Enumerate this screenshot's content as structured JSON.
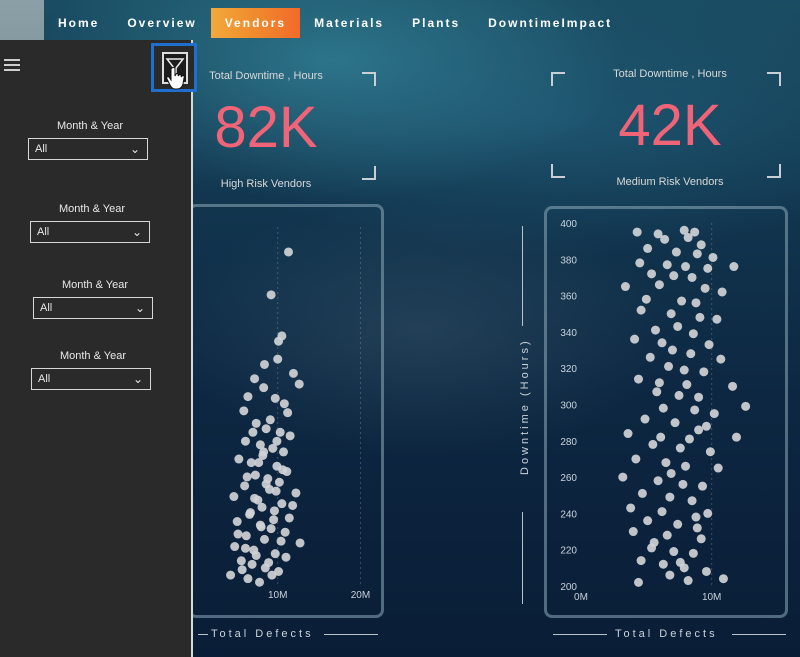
{
  "nav": {
    "tabs": [
      "Home",
      "Overview",
      "Vendors",
      "Materials",
      "Plants",
      "DowntimeImpact"
    ],
    "active": "Vendors"
  },
  "filters": [
    {
      "label": "Month & Year",
      "value": "All"
    },
    {
      "label": "Month & Year",
      "value": "All"
    },
    {
      "label": "Month & Year",
      "value": "All"
    },
    {
      "label": "Month & Year",
      "value": "All"
    }
  ],
  "kpi_high": {
    "title": "Total Downtime , Hours",
    "value": "82K",
    "subtitle": "High Risk Vendors"
  },
  "kpi_medium": {
    "title": "Total Downtime , Hours",
    "value": "42K",
    "subtitle": "Medium Risk Vendors"
  },
  "colors": {
    "accent": "#f06478",
    "active_tab": "#f08a2c",
    "point": "#d0d3d6",
    "filter_highlight": "#1e6fd0"
  },
  "icons": {
    "menu": "hamburger-icon",
    "filter": "filter-funnel-icon",
    "cursor": "hand-pointer-icon",
    "dropdown": "chevron-down-icon"
  },
  "chart_data": [
    {
      "type": "scatter",
      "title": "",
      "xlabel": "Total Defects",
      "ylabel": "",
      "x_ticks": [
        "10M",
        "20M"
      ],
      "xlim": [
        0,
        22
      ],
      "ylim": [
        200,
        400
      ],
      "points": [
        [
          11.3,
          386
        ],
        [
          9.2,
          362
        ],
        [
          10.5,
          339
        ],
        [
          10.1,
          336
        ],
        [
          8.4,
          323
        ],
        [
          10.0,
          326
        ],
        [
          7.2,
          315
        ],
        [
          11.9,
          318
        ],
        [
          8.3,
          310
        ],
        [
          12.6,
          312
        ],
        [
          6.4,
          305
        ],
        [
          9.7,
          304
        ],
        [
          10.8,
          301
        ],
        [
          11.2,
          296
        ],
        [
          5.9,
          297
        ],
        [
          9.1,
          292
        ],
        [
          7.4,
          290
        ],
        [
          8.6,
          287
        ],
        [
          10.3,
          285
        ],
        [
          11.5,
          283
        ],
        [
          6.1,
          280
        ],
        [
          7.9,
          278
        ],
        [
          9.4,
          276
        ],
        [
          10.7,
          274
        ],
        [
          8.2,
          272
        ],
        [
          5.3,
          270
        ],
        [
          6.8,
          268
        ],
        [
          9.9,
          266
        ],
        [
          11.1,
          263
        ],
        [
          7.3,
          261
        ],
        [
          8.8,
          259
        ],
        [
          10.2,
          257
        ],
        [
          6.0,
          255
        ],
        [
          9.0,
          253
        ],
        [
          12.2,
          251
        ],
        [
          4.7,
          249
        ],
        [
          7.6,
          247
        ],
        [
          10.5,
          245
        ],
        [
          8.1,
          243
        ],
        [
          9.6,
          241
        ],
        [
          6.6,
          239
        ],
        [
          11.4,
          237
        ],
        [
          5.1,
          235
        ],
        [
          7.9,
          233
        ],
        [
          9.2,
          231
        ],
        [
          10.9,
          229
        ],
        [
          6.2,
          227
        ],
        [
          8.4,
          225
        ],
        [
          12.7,
          223
        ],
        [
          4.8,
          221
        ],
        [
          7.1,
          219
        ],
        [
          9.7,
          217
        ],
        [
          11.0,
          215
        ],
        [
          5.6,
          213
        ],
        [
          6.9,
          211
        ],
        [
          8.5,
          209
        ],
        [
          10.1,
          207
        ],
        [
          4.3,
          205
        ],
        [
          6.4,
          203
        ],
        [
          7.8,
          201
        ],
        [
          9.3,
          205
        ],
        [
          5.7,
          208
        ],
        [
          8.9,
          212
        ],
        [
          7.4,
          216
        ],
        [
          6.1,
          220
        ],
        [
          10.4,
          224
        ],
        [
          5.2,
          228
        ],
        [
          8.0,
          232
        ],
        [
          9.5,
          236
        ],
        [
          6.7,
          240
        ],
        [
          11.8,
          244
        ],
        [
          7.2,
          248
        ],
        [
          9.8,
          252
        ],
        [
          8.6,
          256
        ],
        [
          6.3,
          260
        ],
        [
          10.6,
          264
        ],
        [
          7.7,
          268
        ],
        [
          8.3,
          274
        ],
        [
          9.9,
          280
        ],
        [
          7.0,
          285
        ]
      ]
    },
    {
      "type": "scatter",
      "title": "",
      "xlabel": "Total Defects",
      "ylabel": "Downtime (Hours)",
      "x_ticks": [
        "0M",
        "10M"
      ],
      "y_ticks": [
        "200",
        "220",
        "240",
        "260",
        "280",
        "300",
        "320",
        "340",
        "360",
        "380",
        "400"
      ],
      "xlim": [
        0,
        15
      ],
      "ylim": [
        200,
        400
      ],
      "points": [
        [
          4.3,
          395
        ],
        [
          5.9,
          394
        ],
        [
          7.9,
          396
        ],
        [
          8.7,
          395
        ],
        [
          6.4,
          391
        ],
        [
          8.2,
          392
        ],
        [
          9.2,
          388
        ],
        [
          5.1,
          386
        ],
        [
          7.3,
          384
        ],
        [
          8.9,
          383
        ],
        [
          10.1,
          381
        ],
        [
          4.5,
          378
        ],
        [
          6.6,
          377
        ],
        [
          8.0,
          376
        ],
        [
          9.7,
          375
        ],
        [
          11.7,
          376
        ],
        [
          5.4,
          372
        ],
        [
          7.1,
          371
        ],
        [
          8.5,
          370
        ],
        [
          3.4,
          365
        ],
        [
          6.0,
          366
        ],
        [
          9.5,
          364
        ],
        [
          10.8,
          362
        ],
        [
          5.0,
          358
        ],
        [
          7.7,
          357
        ],
        [
          8.8,
          356
        ],
        [
          4.6,
          352
        ],
        [
          6.9,
          350
        ],
        [
          9.1,
          348
        ],
        [
          10.4,
          347
        ],
        [
          7.4,
          343
        ],
        [
          5.7,
          341
        ],
        [
          8.6,
          339
        ],
        [
          4.1,
          336
        ],
        [
          6.2,
          334
        ],
        [
          9.8,
          333
        ],
        [
          7.0,
          330
        ],
        [
          8.4,
          328
        ],
        [
          5.3,
          326
        ],
        [
          10.7,
          325
        ],
        [
          6.7,
          321
        ],
        [
          7.9,
          319
        ],
        [
          9.4,
          318
        ],
        [
          4.4,
          314
        ],
        [
          6.0,
          312
        ],
        [
          8.1,
          311
        ],
        [
          11.6,
          310
        ],
        [
          5.8,
          307
        ],
        [
          7.5,
          305
        ],
        [
          9.0,
          304
        ],
        [
          12.6,
          299
        ],
        [
          6.3,
          298
        ],
        [
          8.7,
          297
        ],
        [
          10.2,
          295
        ],
        [
          4.9,
          292
        ],
        [
          7.2,
          290
        ],
        [
          9.6,
          288
        ],
        [
          3.6,
          284
        ],
        [
          6.1,
          282
        ],
        [
          8.3,
          281
        ],
        [
          11.9,
          282
        ],
        [
          5.5,
          278
        ],
        [
          7.6,
          276
        ],
        [
          9.9,
          274
        ],
        [
          4.2,
          270
        ],
        [
          6.5,
          268
        ],
        [
          8.0,
          266
        ],
        [
          10.5,
          265
        ],
        [
          3.2,
          260
        ],
        [
          5.9,
          258
        ],
        [
          7.8,
          256
        ],
        [
          9.3,
          255
        ],
        [
          4.7,
          251
        ],
        [
          6.8,
          249
        ],
        [
          8.5,
          247
        ],
        [
          3.8,
          243
        ],
        [
          6.2,
          241
        ],
        [
          9.7,
          240
        ],
        [
          5.1,
          236
        ],
        [
          7.4,
          234
        ],
        [
          8.9,
          232
        ],
        [
          4.0,
          230
        ],
        [
          6.6,
          228
        ],
        [
          9.2,
          226
        ],
        [
          5.4,
          221
        ],
        [
          7.1,
          219
        ],
        [
          8.6,
          218
        ],
        [
          4.6,
          214
        ],
        [
          6.3,
          212
        ],
        [
          7.9,
          210
        ],
        [
          9.6,
          208
        ],
        [
          4.4,
          202
        ],
        [
          6.8,
          206
        ],
        [
          8.2,
          203
        ],
        [
          10.9,
          204
        ],
        [
          7.6,
          213
        ],
        [
          5.6,
          224
        ],
        [
          8.8,
          238
        ],
        [
          6.9,
          262
        ],
        [
          9.0,
          286
        ]
      ]
    }
  ],
  "axis_labels": {
    "left_x": "Total Defects",
    "right_x": "Total Defects",
    "right_y": "Downtime (Hours)"
  }
}
